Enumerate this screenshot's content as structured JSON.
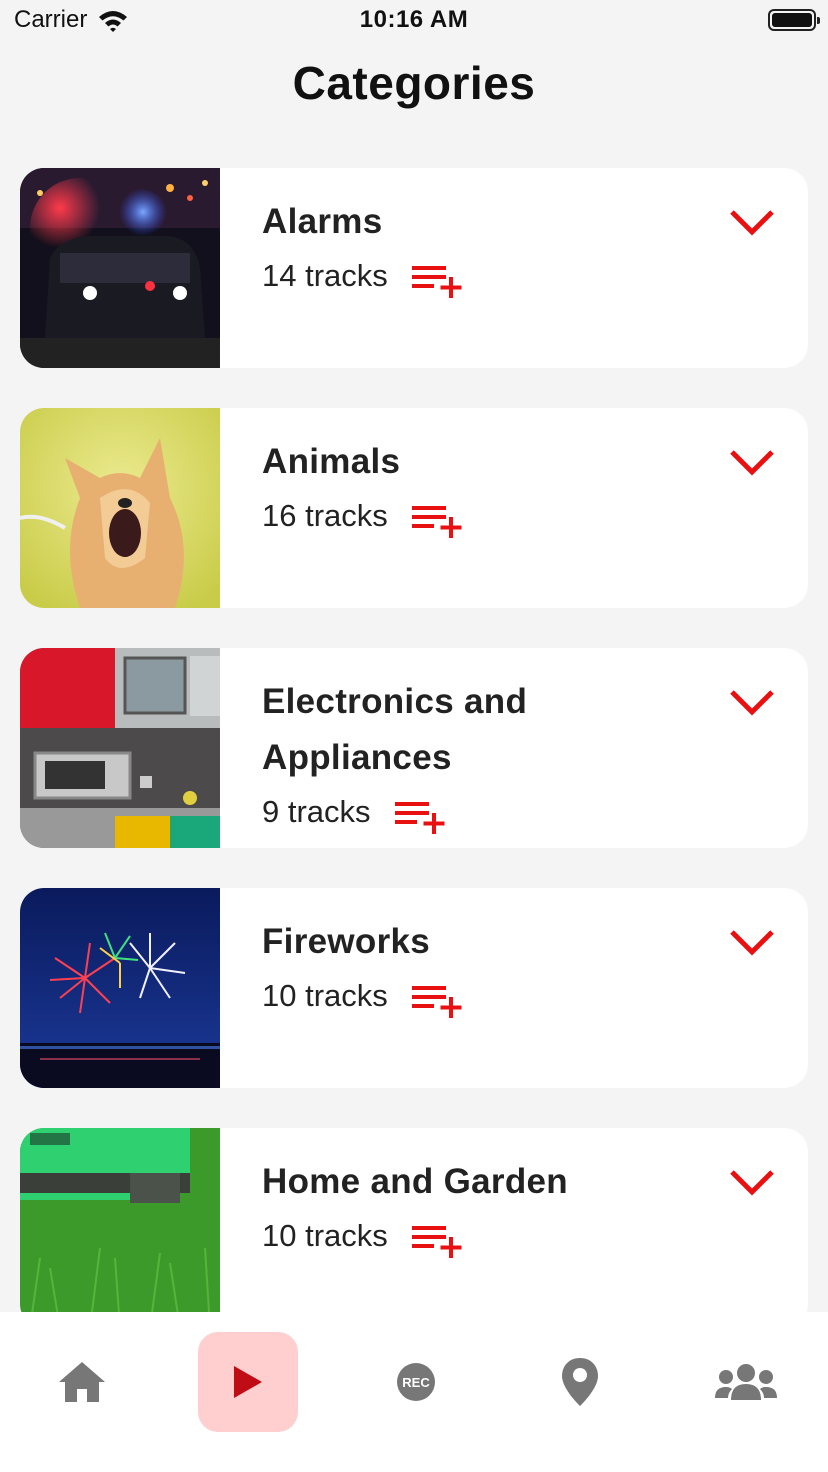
{
  "status_bar": {
    "carrier": "Carrier",
    "time": "10:16 AM"
  },
  "page": {
    "title": "Categories"
  },
  "accent_color": "#e81010",
  "categories": [
    {
      "title": "Alarms",
      "tracks": "14 tracks",
      "image": "police-car-photo"
    },
    {
      "title": "Animals",
      "tracks": "16 tracks",
      "image": "barking-dog-photo"
    },
    {
      "title": "Electronics and Appliances",
      "tracks": "9 tracks",
      "image": "kitchen-appliances-photo"
    },
    {
      "title": "Fireworks",
      "tracks": "10 tracks",
      "image": "fireworks-photo"
    },
    {
      "title": "Home and Garden",
      "tracks": "10 tracks",
      "image": "lawn-mower-photo"
    }
  ],
  "tab_bar": {
    "tabs": [
      {
        "icon": "home-icon",
        "active": false
      },
      {
        "icon": "play-icon",
        "active": true
      },
      {
        "icon": "rec-icon",
        "label": "REC",
        "active": false
      },
      {
        "icon": "location-pin-icon",
        "active": false
      },
      {
        "icon": "users-icon",
        "active": false
      }
    ]
  }
}
